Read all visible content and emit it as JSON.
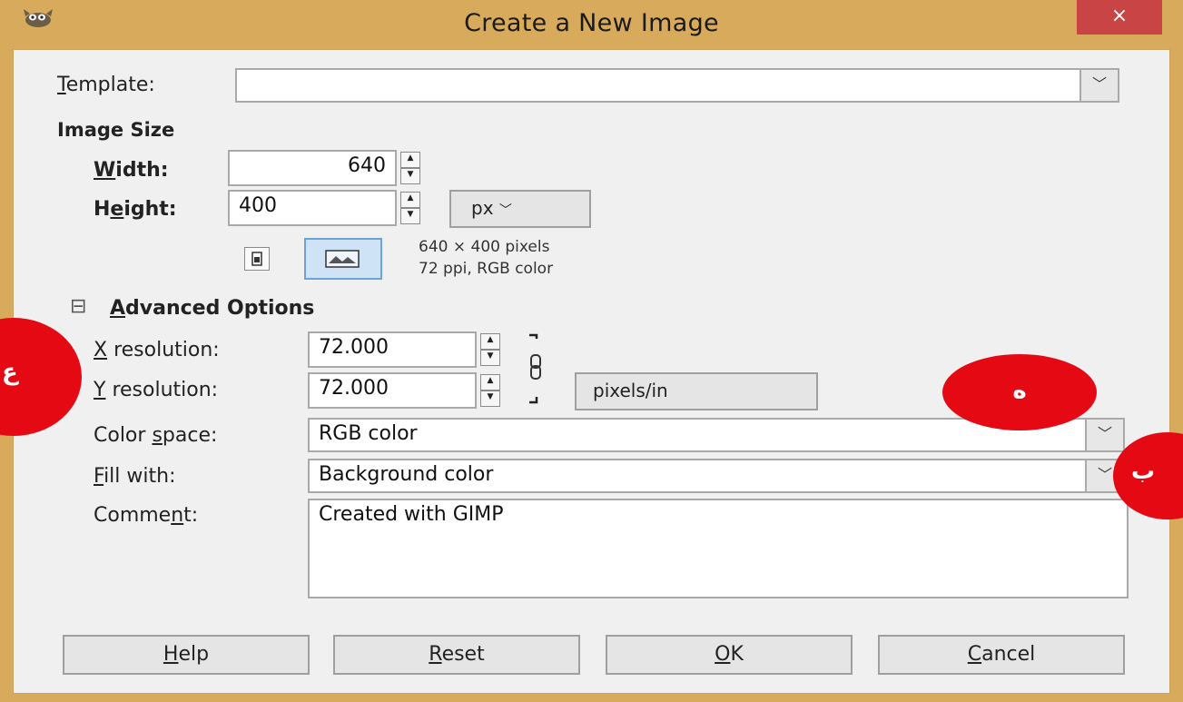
{
  "window": {
    "title": "Create a New Image",
    "close_glyph": "×",
    "app_icon": "gimp-wilber-icon"
  },
  "template": {
    "label_first": "T",
    "label_rest": "emplate:",
    "value": ""
  },
  "image_size": {
    "heading": "Image Size",
    "width_label_first": "W",
    "width_label_rest": "idth:",
    "width_value": "640",
    "height_label_pre": "H",
    "height_label_underline": "e",
    "height_label_rest": "ight:",
    "height_value": "400",
    "unit": "px",
    "info_line1": "640 × 400 pixels",
    "info_line2": "72 ppi, RGB color",
    "portrait_icon": "portrait-icon",
    "landscape_icon": "landscape-icon"
  },
  "advanced": {
    "heading_first": "A",
    "heading_rest": "dvanced Options",
    "expander_glyph": "⊟",
    "x_res_label_first": "X",
    "x_res_label_rest": " resolution:",
    "x_res_value": "72.000",
    "y_res_label_first": "Y",
    "y_res_label_rest": " resolution:",
    "y_res_value": "72.000",
    "res_unit": "pixels/in",
    "color_space_label_pre": "Color ",
    "color_space_label_u": "s",
    "color_space_label_rest": "pace:",
    "color_space_value": "RGB color",
    "fill_label_first": "F",
    "fill_label_rest": "ill with:",
    "fill_value": "Background color",
    "comment_label_pre": "Comme",
    "comment_label_u": "n",
    "comment_label_rest": "t:",
    "comment_value": "Created with GIMP"
  },
  "buttons": {
    "help_first": "H",
    "help_rest": "elp",
    "reset_first": "R",
    "reset_rest": "eset",
    "ok_first": "O",
    "ok_rest": "K",
    "cancel_first": "C",
    "cancel_rest": "ancel"
  },
  "markers": {
    "left": "ع",
    "middle": "ە",
    "right": "ب",
    "color": "#e50914"
  },
  "colors": {
    "frame": "#d8aa5c",
    "close": "#c94545",
    "dialog_bg": "#f0f0f0"
  }
}
